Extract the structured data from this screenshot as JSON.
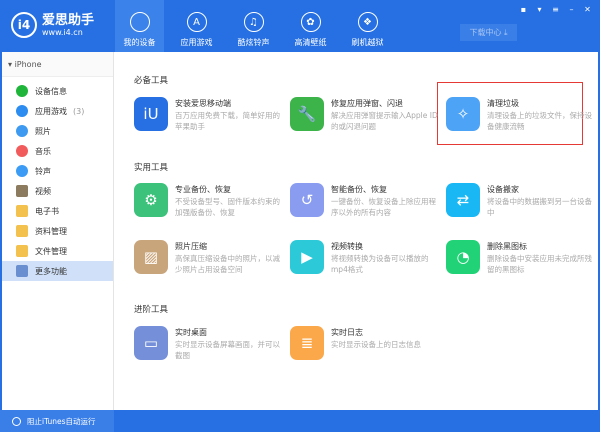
{
  "app": {
    "name": "爱思助手",
    "url": "www.i4.cn",
    "logo": "i4"
  },
  "nav": [
    {
      "label": "我的设备",
      "icon": "apple-icon",
      "active": true
    },
    {
      "label": "应用游戏",
      "icon": "app-store-icon"
    },
    {
      "label": "酷炫铃声",
      "icon": "music-note-icon"
    },
    {
      "label": "高清壁纸",
      "icon": "flower-icon"
    },
    {
      "label": "刷机越狱",
      "icon": "dropbox-icon"
    }
  ],
  "window_controls": [
    "feedback-icon",
    "skin-icon",
    "menu-icon",
    "minimize-icon",
    "close-icon"
  ],
  "download_center": "下载中心",
  "sidebar": {
    "device": "iPhone",
    "items": [
      {
        "label": "设备信息",
        "icon": "info-icon",
        "color": "#1fb53a"
      },
      {
        "label": "应用游戏",
        "count": "(3)",
        "icon": "app-store-icon",
        "color": "#2d8cf0"
      },
      {
        "label": "照片",
        "icon": "photo-icon",
        "color": "#3d9af0"
      },
      {
        "label": "音乐",
        "icon": "music-icon",
        "color": "#f25b5b"
      },
      {
        "label": "铃声",
        "icon": "bell-icon",
        "color": "#3c9cf5"
      },
      {
        "label": "视频",
        "icon": "video-icon",
        "color": "#8c7b5e"
      },
      {
        "label": "电子书",
        "icon": "book-icon",
        "color": "#f2c14e"
      },
      {
        "label": "资料管理",
        "icon": "contacts-icon",
        "color": "#f2c14e"
      },
      {
        "label": "文件管理",
        "icon": "file-icon",
        "color": "#f2c14e"
      },
      {
        "label": "更多功能",
        "icon": "more-icon",
        "color": "#6a8fd0",
        "selected": true
      }
    ]
  },
  "sections": [
    {
      "title": "必备工具",
      "tools": [
        {
          "name": "安装爱思移动端",
          "desc": "百万应用免费下载，简单好用的苹果助手",
          "icon": "i4-icon",
          "color": "#2670e3"
        },
        {
          "name": "修复应用弹窗、闪退",
          "desc": "解决应用弹窗提示输入Apple ID的或闪退问题",
          "icon": "wrench-icon",
          "color": "#3cb44a"
        },
        {
          "name": "清理垃圾",
          "desc": "清理设备上的垃圾文件，保持设备健康流畅",
          "icon": "broom-icon",
          "color": "#4da3f5",
          "highlighted": true
        }
      ]
    },
    {
      "title": "实用工具",
      "tools": [
        {
          "name": "专业备份、恢复",
          "desc": "不受设备型号、固件版本约束的加强版备份、恢复",
          "icon": "gears-backup-icon",
          "color": "#3cc27a"
        },
        {
          "name": "智能备份、恢复",
          "desc": "一键备份、恢复设备上除应用程序以外的所有内容",
          "icon": "clock-restore-icon",
          "color": "#8a9cf0"
        },
        {
          "name": "设备搬家",
          "desc": "将设备中的数据搬到另一台设备中",
          "icon": "migrate-icon",
          "color": "#19b8f5"
        },
        {
          "name": "照片压缩",
          "desc": "高保真压缩设备中的照片，以减少照片占用设备空间",
          "icon": "image-icon",
          "color": "#c9a57c"
        },
        {
          "name": "视频转换",
          "desc": "将视频转换为设备可以播放的mp4格式",
          "icon": "play-icon",
          "color": "#2cc9d8"
        },
        {
          "name": "删除黑图标",
          "desc": "删除设备中安装应用未完成所残留的黑图标",
          "icon": "pie-icon",
          "color": "#22d277"
        }
      ]
    },
    {
      "title": "进阶工具",
      "tools": [
        {
          "name": "实时桌面",
          "desc": "实时显示设备屏幕画面，并可以截图",
          "icon": "monitor-icon",
          "color": "#7590d8"
        },
        {
          "name": "实时日志",
          "desc": "实时显示设备上的日志信息",
          "icon": "document-icon",
          "color": "#fba84a"
        }
      ]
    }
  ],
  "footer": {
    "itunes_toggle": "阻止iTunes自动运行"
  },
  "colors": {
    "brand": "#2670e3",
    "highlight": "#e53935"
  }
}
